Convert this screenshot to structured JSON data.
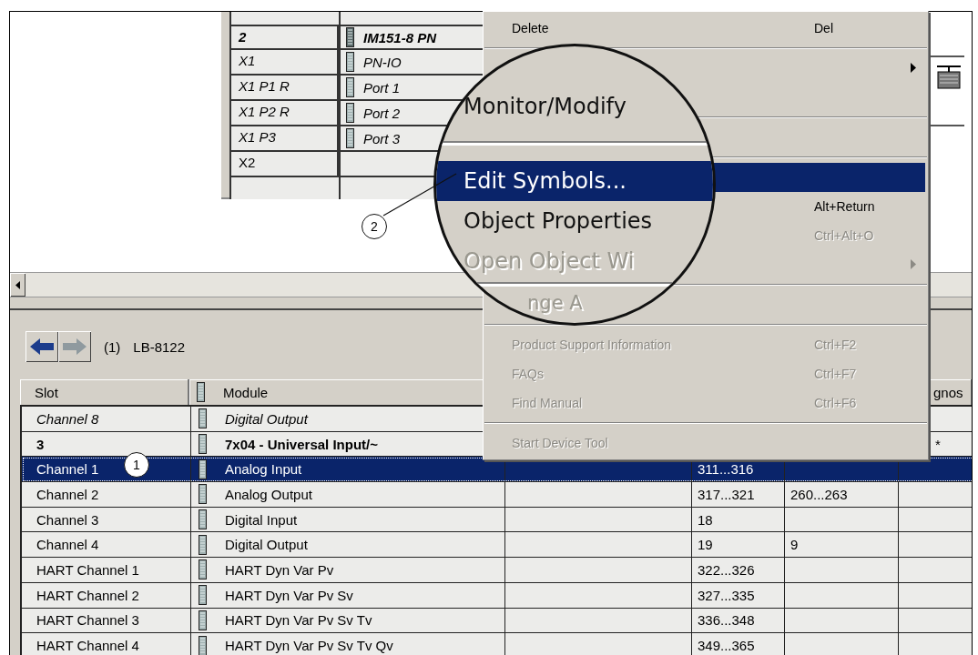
{
  "upper_table": {
    "rows": [
      {
        "slot": "2",
        "module": "IM151-8 PN",
        "bold": true,
        "italic": true
      },
      {
        "slot": "X1",
        "module": "PN-IO",
        "bold": false,
        "italic": true
      },
      {
        "slot": "X1 P1 R",
        "module": "Port 1",
        "bold": false,
        "italic": true
      },
      {
        "slot": "X1 P2 R",
        "module": "Port 2",
        "bold": false,
        "italic": true
      },
      {
        "slot": "X1 P3",
        "module": "Port 3",
        "bold": false,
        "italic": true
      },
      {
        "slot": "X2",
        "module": "",
        "bold": false,
        "italic": false
      }
    ]
  },
  "context_menu": {
    "items": [
      {
        "kind": "item",
        "label": "Delete",
        "shortcut": "Del",
        "submenu": false,
        "disabled": false,
        "selected": false
      },
      {
        "kind": "separator"
      },
      {
        "kind": "item",
        "submenu": true,
        "disabled": false,
        "selected": false
      },
      {
        "kind": "blank"
      },
      {
        "kind": "separator"
      },
      {
        "kind": "blank"
      },
      {
        "kind": "separator"
      },
      {
        "kind": "item",
        "submenu": false,
        "selected": true
      },
      {
        "kind": "item",
        "shortcut": "Alt+Return",
        "submenu": false,
        "disabled": false,
        "selected": false
      },
      {
        "kind": "item",
        "shortcut": "Ctrl+Alt+O",
        "submenu": false,
        "disabled": true,
        "selected": false
      },
      {
        "kind": "item",
        "submenu": true,
        "disabled": true,
        "selected": false
      },
      {
        "kind": "separator"
      },
      {
        "kind": "blank"
      },
      {
        "kind": "separator"
      },
      {
        "kind": "item",
        "label": "Product Support Information",
        "shortcut": "Ctrl+F2",
        "submenu": false,
        "disabled": true,
        "selected": false
      },
      {
        "kind": "item",
        "label": "FAQs",
        "shortcut": "Ctrl+F7",
        "submenu": false,
        "disabled": true,
        "selected": false
      },
      {
        "kind": "item",
        "label": "Find Manual",
        "shortcut": "Ctrl+F6",
        "submenu": false,
        "disabled": true,
        "selected": false
      },
      {
        "kind": "separator"
      },
      {
        "kind": "item",
        "label": "Start Device Tool",
        "submenu": false,
        "disabled": true,
        "selected": false
      }
    ]
  },
  "magnifier": {
    "items": [
      {
        "kind": "item",
        "label": "Monitor/Modify",
        "disabled": false,
        "selected": false
      },
      {
        "kind": "separator"
      },
      {
        "kind": "item",
        "label": "Edit Symbols...",
        "disabled": false,
        "selected": true
      },
      {
        "kind": "item",
        "label": "Object Properties",
        "disabled": false,
        "selected": false
      },
      {
        "kind": "item",
        "label": "Open Object Wi",
        "disabled": true,
        "selected": false
      },
      {
        "kind": "separator"
      },
      {
        "kind": "item",
        "label": "nge A",
        "disabled": true,
        "selected": false
      }
    ]
  },
  "station": {
    "number": "(1)",
    "name": "LB-8122"
  },
  "lower_table": {
    "columns": [
      "Slot",
      "Module",
      "",
      "",
      "",
      "gnos"
    ],
    "rows": [
      {
        "cells": [
          "Channel 8",
          "Digital Output",
          "",
          "",
          "",
          ""
        ],
        "bold": false,
        "italic": true,
        "selected": false
      },
      {
        "cells": [
          "3",
          "7x04 - Universal Input/~",
          "",
          "",
          "",
          "*"
        ],
        "bold": true,
        "italic": false,
        "selected": false
      },
      {
        "cells": [
          "Channel 1",
          "Analog Input",
          "",
          "311...316",
          "",
          ""
        ],
        "bold": false,
        "italic": false,
        "selected": true
      },
      {
        "cells": [
          "Channel 2",
          "Analog Output",
          "",
          "317...321",
          "260...263",
          ""
        ],
        "bold": false,
        "italic": false,
        "selected": false
      },
      {
        "cells": [
          "Channel 3",
          "Digital Input",
          "",
          "18",
          "",
          ""
        ],
        "bold": false,
        "italic": false,
        "selected": false
      },
      {
        "cells": [
          "Channel 4",
          "Digital Output",
          "",
          "19",
          "9",
          ""
        ],
        "bold": false,
        "italic": false,
        "selected": false
      },
      {
        "cells": [
          "HART Channel 1",
          "HART Dyn Var Pv",
          "",
          "322...326",
          "",
          ""
        ],
        "bold": false,
        "italic": false,
        "selected": false
      },
      {
        "cells": [
          "HART Channel 2",
          "HART Dyn Var Pv Sv",
          "",
          "327...335",
          "",
          ""
        ],
        "bold": false,
        "italic": false,
        "selected": false
      },
      {
        "cells": [
          "HART Channel 3",
          "HART Dyn Var Pv Sv Tv",
          "",
          "336...348",
          "",
          ""
        ],
        "bold": false,
        "italic": false,
        "selected": false
      },
      {
        "cells": [
          "HART Channel 4",
          "HART Dyn Var Pv Sv Tv Qv",
          "",
          "349...365",
          "",
          ""
        ],
        "bold": false,
        "italic": false,
        "selected": false
      }
    ]
  },
  "callouts": [
    {
      "label": "1"
    },
    {
      "label": "2"
    }
  ]
}
